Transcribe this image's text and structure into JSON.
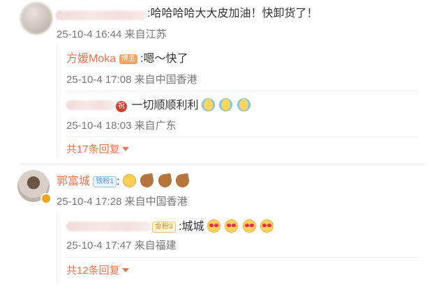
{
  "comment1": {
    "text": ":哈哈哈哈大大皮加油！快卸货了！",
    "meta": "25-10-4 16:44 来自江苏",
    "replies": [
      {
        "name": "方媛Moka",
        "badge": "博主",
        "text": ":嗯～快了",
        "meta": "25-10-4 17:08 来自中国香港"
      },
      {
        "badge": "祝",
        "text": "一切顺顺利利",
        "emojis": [
          "crying-face",
          "crying-face",
          "crying-face"
        ],
        "meta": "25-10-4 18:03 来自广东"
      }
    ],
    "more_label": "共17条回复"
  },
  "comment2": {
    "name": "郭富城",
    "badge": "铁粉1",
    "emojis": [
      "grin-face",
      "flexed-biceps",
      "flexed-biceps",
      "flexed-biceps"
    ],
    "meta": "25-10-4 17:28 来自中国香港",
    "replies": [
      {
        "badge": "金粉3",
        "text": ":城城",
        "emojis": [
          "heart-eyes-face",
          "heart-eyes-face",
          "heart-eyes-face",
          "heart-eyes-face"
        ],
        "meta": "25-10-4 17:47 来自福建"
      }
    ],
    "more_label": "共12条回复"
  },
  "colors": {
    "name": "#eb7350",
    "text": "#333333",
    "meta": "#777777",
    "tag_blogger": "#f7a35b",
    "tag_fan": "#6aa6f0",
    "tag_gold": "#f0b23a"
  }
}
